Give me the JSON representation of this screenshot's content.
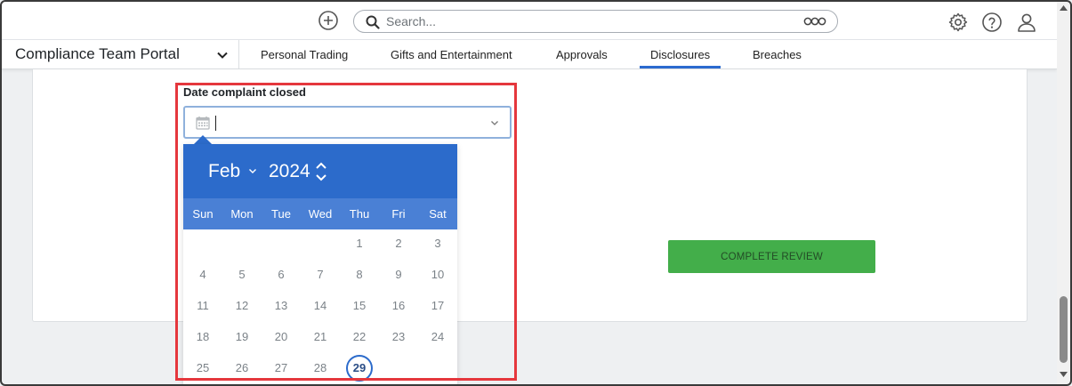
{
  "header": {
    "search_placeholder": "Search...",
    "icons": [
      "plus-circle-icon",
      "search-icon",
      "more-icon",
      "settings-icon",
      "help-icon",
      "user-icon"
    ]
  },
  "nav": {
    "portal_title": "Compliance Team Portal",
    "tabs": [
      {
        "label": "Personal Trading",
        "active": false
      },
      {
        "label": "Gifts and Entertainment",
        "active": false
      },
      {
        "label": "Approvals",
        "active": false
      },
      {
        "label": "Disclosures",
        "active": true
      },
      {
        "label": "Breaches",
        "active": false
      }
    ]
  },
  "form": {
    "date_label": "Date complaint closed",
    "date_value": "",
    "complete_button": "COMPLETE REVIEW"
  },
  "datepicker": {
    "month": "Feb",
    "year": "2024",
    "weekdays": [
      "Sun",
      "Mon",
      "Tue",
      "Wed",
      "Thu",
      "Fri",
      "Sat"
    ],
    "weeks": [
      [
        "",
        "",
        "",
        "",
        "1",
        "2",
        "3"
      ],
      [
        "4",
        "5",
        "6",
        "7",
        "8",
        "9",
        "10"
      ],
      [
        "11",
        "12",
        "13",
        "14",
        "15",
        "16",
        "17"
      ],
      [
        "18",
        "19",
        "20",
        "21",
        "22",
        "23",
        "24"
      ],
      [
        "25",
        "26",
        "27",
        "28",
        "29",
        "",
        ""
      ]
    ],
    "today": "29"
  },
  "colors": {
    "accent": "#2c6bcb",
    "weekday_bar": "#4a80d5",
    "complete_button": "#43ae4a",
    "highlight": "#e5373d"
  }
}
